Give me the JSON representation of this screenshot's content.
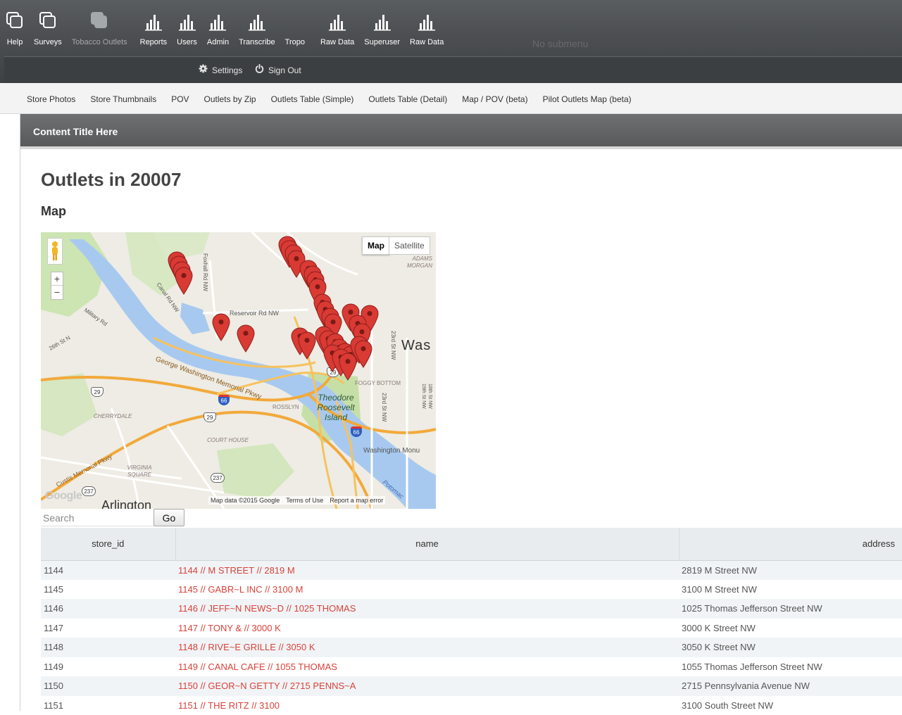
{
  "nav": {
    "items": [
      {
        "label": "Help",
        "icon": "help-icon",
        "dim": false
      },
      {
        "label": "Surveys",
        "icon": "surveys-icon",
        "dim": false
      },
      {
        "label": "Tobacco Outlets",
        "icon": "tobacco-outlets-icon",
        "dim": true
      },
      {
        "label": "Reports",
        "icon": "bar-chart-icon",
        "dim": false
      },
      {
        "label": "Users",
        "icon": "bar-chart-icon",
        "dim": false
      },
      {
        "label": "Admin",
        "icon": "bar-chart-icon",
        "dim": false
      },
      {
        "label": "Transcribe",
        "icon": "bar-chart-icon",
        "dim": false
      },
      {
        "label": "Tropo",
        "icon": "",
        "dim": false
      },
      {
        "label": "Raw Data",
        "icon": "bar-chart-icon",
        "dim": false
      },
      {
        "label": "Superuser",
        "icon": "bar-chart-icon",
        "dim": false
      },
      {
        "label": "Raw Data",
        "icon": "bar-chart-icon",
        "dim": false
      }
    ],
    "no_submenu": "No submenu",
    "settings_label": "Settings",
    "signout_label": "Sign Out"
  },
  "submenu": [
    "Store Photos",
    "Store Thumbnails",
    "POV",
    "Outlets by Zip",
    "Outlets Table (Simple)",
    "Outlets Table (Detail)",
    "Map / POV (beta)",
    "Pilot Outlets Map (beta)"
  ],
  "content": {
    "panel_title": "Content Title Here",
    "page_title": "Outlets in 20007",
    "section_title": "Map"
  },
  "map": {
    "type_buttons": {
      "map": "Map",
      "satellite": "Satellite"
    },
    "labels": {
      "neighborhood1": "ADAMS MORGAN",
      "city": "Was",
      "island": "Theodore Roosevelt Island",
      "foggy_bottom": "FOGGY BOTTOM",
      "rosslyn": "ROSSLYN",
      "court_house": "COURT HOUSE",
      "cherrydale": "CHERRYDALE",
      "virginia_square": "VIRGINIA SQUARE",
      "arlington": "Arlington",
      "monument": "Washington Monu",
      "reservoir_rd": "Reservoir Rd NW",
      "gw_pkwy": "George Washington Memorial Pkwy",
      "canal_rd": "Canal Rd NW",
      "foxhall_rd": "Foxhall Rd NW",
      "military_rd": "Military Rd",
      "st_26th": "26th St N",
      "st_23rd": "23rd St NW",
      "st_18th": "18th St NW",
      "st_19th": "19th St NW",
      "custis_pkwy": "Custis Memorial Pkwy",
      "potomac": "Potomac",
      "shield_29": "29",
      "shield_66": "66",
      "shield_237": "237"
    },
    "attribution": {
      "data": "Map data ©2015 Google",
      "terms": "Terms of Use",
      "report": "Report a map error"
    },
    "google_logo": "Google",
    "marker_color": "#d93a34"
  },
  "search": {
    "placeholder": "Search",
    "button": "Go"
  },
  "table": {
    "headers": [
      "store_id",
      "name",
      "address"
    ],
    "rows": [
      {
        "store_id": "1144",
        "name": "1144 // M STREET // 2819 M",
        "address": "2819 M Street NW"
      },
      {
        "store_id": "1145",
        "name": "1145 // GABR~L INC // 3100 M",
        "address": "3100 M Street NW"
      },
      {
        "store_id": "1146",
        "name": "1146 // JEFF~N NEWS~D // 1025 THOMAS",
        "address": "1025 Thomas Jefferson Street NW"
      },
      {
        "store_id": "1147",
        "name": "1147 // TONY & // 3000 K",
        "address": "3000 K Street NW"
      },
      {
        "store_id": "1148",
        "name": "1148 // RIVE~E GRILLE // 3050 K",
        "address": "3050 K Street NW"
      },
      {
        "store_id": "1149",
        "name": "1149 // CANAL CAFE // 1055 THOMAS",
        "address": "1055 Thomas Jefferson Street NW"
      },
      {
        "store_id": "1150",
        "name": "1150 // GEOR~N GETTY // 2715 PENNS~A",
        "address": "2715 Pennsylvania Avenue NW"
      },
      {
        "store_id": "1151",
        "name": "1151 // THE RITZ // 3100",
        "address": "3100 South Street NW"
      }
    ]
  },
  "colors": {
    "link": "#d9423a",
    "nav_bg": "#4d5052",
    "panel_header": "#606264"
  }
}
